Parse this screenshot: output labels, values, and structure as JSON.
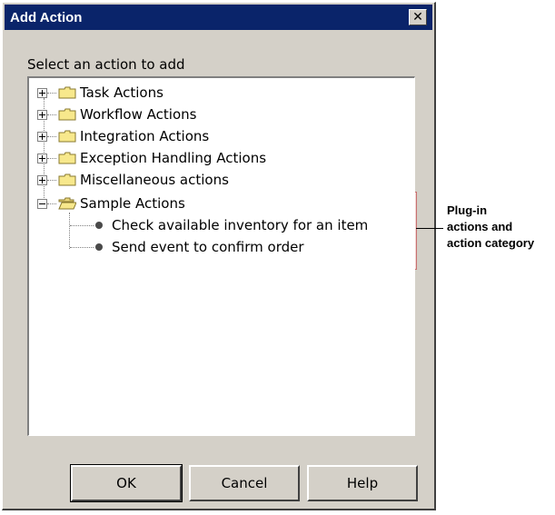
{
  "dialog": {
    "title": "Add Action",
    "close_glyph": "✕"
  },
  "prompt": "Select an action to add",
  "tree": {
    "categories": [
      {
        "label": "Task Actions",
        "expanded": false
      },
      {
        "label": "Workflow Actions",
        "expanded": false
      },
      {
        "label": "Integration Actions",
        "expanded": false
      },
      {
        "label": "Exception Handling Actions",
        "expanded": false
      },
      {
        "label": "Miscellaneous actions",
        "expanded": false
      },
      {
        "label": "Sample Actions",
        "expanded": true,
        "children": [
          {
            "label": "Check available inventory for an item"
          },
          {
            "label": "Send event to confirm order"
          }
        ]
      }
    ]
  },
  "buttons": {
    "ok": "OK",
    "cancel": "Cancel",
    "help": "Help"
  },
  "callout": {
    "lines": [
      "Plug-in",
      "actions and",
      "action category"
    ]
  },
  "colors": {
    "titlebar": "#0a246a",
    "dialog_bg": "#d4d0c8",
    "folder_fill": "#f7e88c",
    "highlight": "#fcdad8"
  }
}
